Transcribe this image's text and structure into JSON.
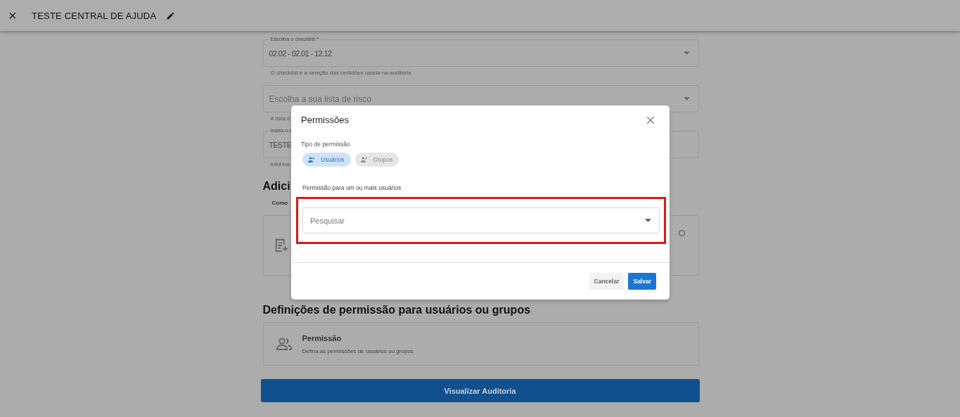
{
  "header": {
    "close": "×",
    "title": "TESTE CENTRAL DE AJUDA"
  },
  "fields": [
    {
      "label": "Escolha o checklist *",
      "value": "02.02 - 02.01 - 12.12",
      "helper": "O checklist é a seleção das certidões usada na auditoria",
      "dropdown": true
    },
    {
      "placeholder": "Escolha a sua lista de risco",
      "helper": "A lista d",
      "dropdown": true
    },
    {
      "label": "Insira o c",
      "value": "TESTE",
      "helper": "Informa",
      "dropdown": false
    }
  ],
  "add_section": {
    "heading": "Adici",
    "subheading": "Como",
    "option_selected": false
  },
  "permission_section": {
    "heading": "Definições de permissão para usuários ou grupos",
    "card_title": "Permissão",
    "card_text": "Defina as permissões de usuários ou grupos"
  },
  "main_button": "Visualizar Auditoria",
  "dialog": {
    "title": "Permissões",
    "type_label": "Tipo de permissão",
    "types": [
      {
        "label": "Usuários",
        "selected": true
      },
      {
        "label": "Grupos",
        "selected": false
      }
    ],
    "search_label": "Permissão para um ou mais usuários",
    "search": {
      "placeholder": "Pesquisar"
    },
    "buttons": [
      {
        "label": "Cancelar",
        "kind": "secondary"
      },
      {
        "label": "Salvar",
        "kind": "primary"
      }
    ]
  }
}
